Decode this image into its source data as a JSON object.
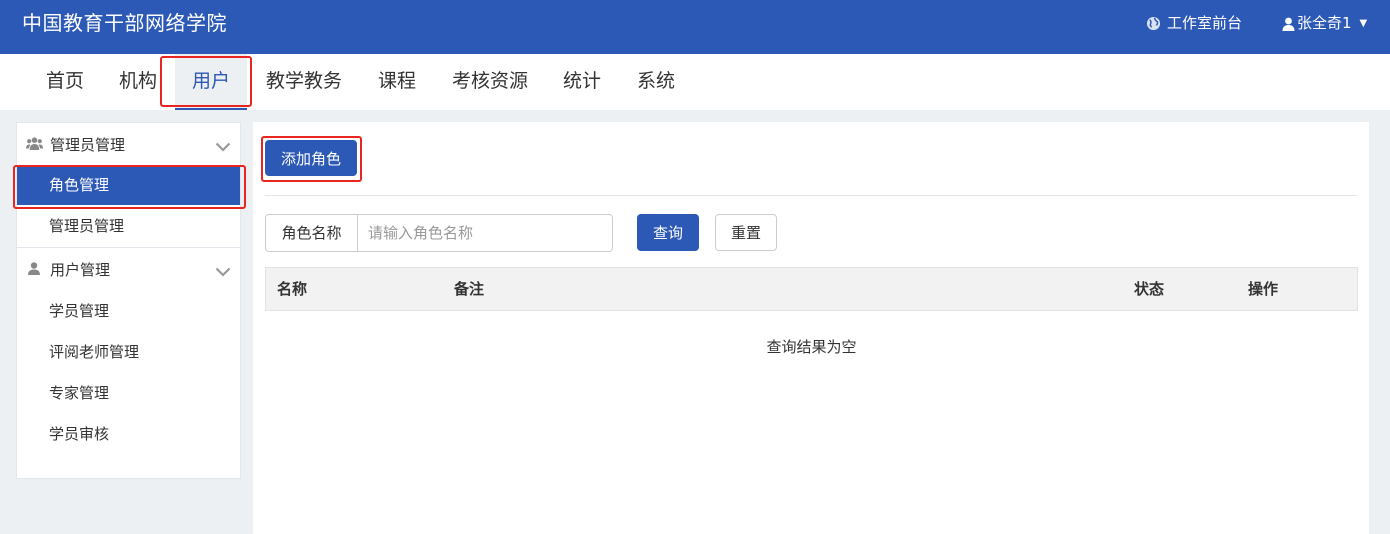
{
  "header": {
    "title": "中国教育干部网络学院",
    "studio_link": "工作室前台",
    "user_name": "张全奇1"
  },
  "nav": {
    "items": [
      {
        "label": "首页"
      },
      {
        "label": "机构"
      },
      {
        "label": "用户"
      },
      {
        "label": "教学教务"
      },
      {
        "label": "课程"
      },
      {
        "label": "考核资源"
      },
      {
        "label": "统计"
      },
      {
        "label": "系统"
      }
    ],
    "active": "用户"
  },
  "sidebar": {
    "groups": [
      {
        "label": "管理员管理",
        "icon": "users-icon",
        "items": [
          {
            "label": "角色管理",
            "active": true
          },
          {
            "label": "管理员管理"
          }
        ]
      },
      {
        "label": "用户管理",
        "icon": "user-icon",
        "items": [
          {
            "label": "学员管理"
          },
          {
            "label": "评阅老师管理"
          },
          {
            "label": "专家管理"
          },
          {
            "label": "学员审核"
          }
        ]
      }
    ]
  },
  "main": {
    "add_button": "添加角色",
    "search": {
      "label": "角色名称",
      "placeholder": "请输入角色名称",
      "query_button": "查询",
      "reset_button": "重置"
    },
    "table": {
      "columns": [
        "名称",
        "备注",
        "状态",
        "操作"
      ],
      "empty_text": "查询结果为空"
    }
  },
  "colors": {
    "primary": "#2c59b6",
    "highlight_box": "#e8251f",
    "page_bg": "#edf0f3"
  }
}
